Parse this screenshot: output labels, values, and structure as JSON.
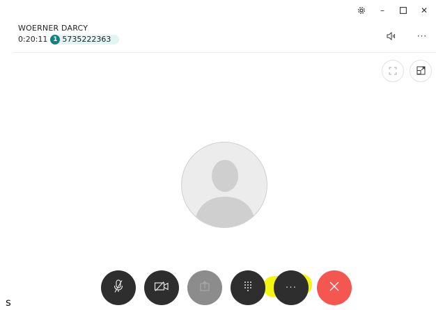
{
  "window": {
    "icons": [
      "gear-icon",
      "minimize-icon",
      "maximize-icon",
      "close-icon"
    ],
    "minimize_glyph": "–",
    "close_glyph": "✕"
  },
  "call": {
    "caller_name": "WOERNER DARCY",
    "duration": "0:20:11",
    "line_badge": "1",
    "phone_number": "5735222363"
  },
  "header_actions": {
    "icons": [
      "speaker-icon",
      "more-options-icon"
    ],
    "more_glyph": "···"
  },
  "view_controls": {
    "icons": [
      "fullscreen-icon",
      "picture-in-picture-icon"
    ]
  },
  "controls": {
    "buttons": [
      {
        "name": "mute-button",
        "icon": "microphone-muted-icon"
      },
      {
        "name": "video-button",
        "icon": "video-off-icon"
      },
      {
        "name": "share-button",
        "icon": "share-icon"
      },
      {
        "name": "keypad-button",
        "icon": "dialpad-icon"
      },
      {
        "name": "more-button",
        "icon": "more-dots-icon"
      },
      {
        "name": "end-call-button",
        "icon": "end-call-icon"
      }
    ],
    "more_glyph": "···"
  },
  "stray_text": "s",
  "colors": {
    "badge": "#16817f",
    "chip_bg": "#e3f4f5",
    "control_dark": "#2e2e2e",
    "control_disabled": "#8c8c8c",
    "end_call": "#f4574f",
    "highlight": "#f3f500"
  }
}
